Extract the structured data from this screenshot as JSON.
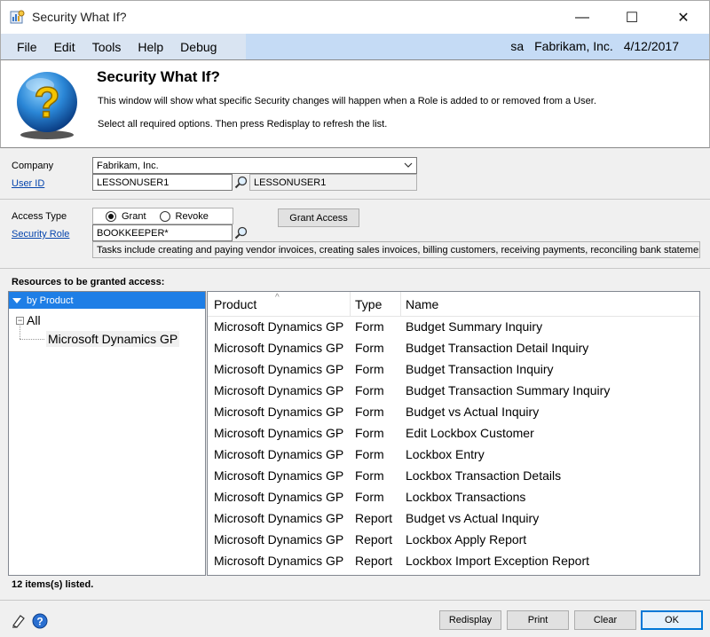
{
  "window": {
    "title": "Security What If?",
    "minimize": "—",
    "maximize": "☐",
    "close": "✕"
  },
  "menu": {
    "items": [
      "File",
      "Edit",
      "Tools",
      "Help",
      "Debug"
    ],
    "user": "sa",
    "company": "Fabrikam, Inc.",
    "date": "4/12/2017"
  },
  "header": {
    "title": "Security What If?",
    "description": "This window will show what specific Security changes will happen when a Role is added to or removed from a User.",
    "instruction": "Select all required options.  Then press Redisplay to refresh the list."
  },
  "form": {
    "company_label": "Company",
    "company_value": "Fabrikam, Inc.",
    "userid_label": "User ID",
    "userid_value": "LESSONUSER1",
    "userid_name": "LESSONUSER1",
    "access_type_label": "Access Type",
    "grant_label": "Grant",
    "revoke_label": "Revoke",
    "grant_selected": true,
    "grant_access_button": "Grant Access",
    "security_role_label": "Security Role",
    "security_role_value": "BOOKKEEPER*",
    "role_description": "Tasks include creating and paying vendor invoices, creating sales invoices, billing customers, receiving payments, reconciling bank statements,"
  },
  "resources": {
    "label": "Resources to be granted access:",
    "view_selector": "by Product",
    "tree_root": "All",
    "tree_child": "Microsoft Dynamics GP",
    "columns": [
      "Product",
      "Type",
      "Name"
    ],
    "rows": [
      [
        "Microsoft Dynamics GP",
        "Form",
        "Budget Summary Inquiry"
      ],
      [
        "Microsoft Dynamics GP",
        "Form",
        "Budget Transaction Detail Inquiry"
      ],
      [
        "Microsoft Dynamics GP",
        "Form",
        "Budget Transaction Inquiry"
      ],
      [
        "Microsoft Dynamics GP",
        "Form",
        "Budget Transaction Summary Inquiry"
      ],
      [
        "Microsoft Dynamics GP",
        "Form",
        "Budget vs Actual Inquiry"
      ],
      [
        "Microsoft Dynamics GP",
        "Form",
        "Edit Lockbox Customer"
      ],
      [
        "Microsoft Dynamics GP",
        "Form",
        "Lockbox Entry"
      ],
      [
        "Microsoft Dynamics GP",
        "Form",
        "Lockbox Transaction Details"
      ],
      [
        "Microsoft Dynamics GP",
        "Form",
        "Lockbox Transactions"
      ],
      [
        "Microsoft Dynamics GP",
        "Report",
        "Budget vs Actual Inquiry"
      ],
      [
        "Microsoft Dynamics GP",
        "Report",
        "Lockbox Apply Report"
      ],
      [
        "Microsoft Dynamics GP",
        "Report",
        "Lockbox Import Exception Report"
      ]
    ],
    "count_text": "12 items(s) listed."
  },
  "buttons": {
    "redisplay": "Redisplay",
    "print": "Print",
    "clear": "Clear",
    "ok": "OK"
  },
  "icons": {
    "app": "security-window-icon",
    "header": "question-mark-globe-icon",
    "lookup": "magnifier-icon",
    "note": "note-icon",
    "help": "help-icon"
  },
  "colors": {
    "menubar": "#c5dbf5",
    "selection": "#1e7ee6",
    "link": "#0645ad"
  }
}
